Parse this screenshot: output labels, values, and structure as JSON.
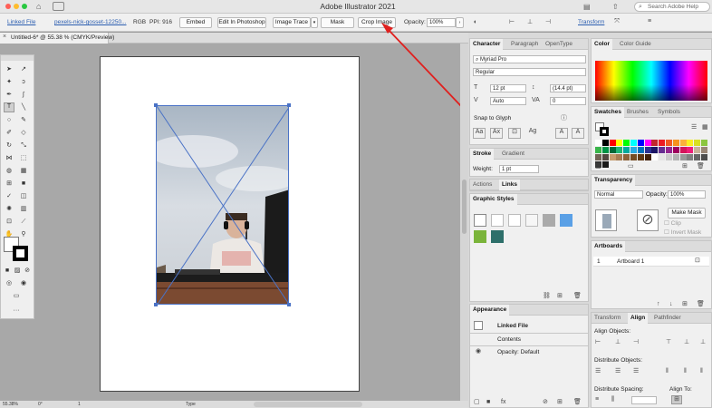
{
  "window": {
    "title": "Adobe Illustrator 2021",
    "search_placeholder": "Search Adobe Help"
  },
  "control_bar": {
    "linked_file": "Linked File",
    "filename": "pexels-nick-gosset-12250...",
    "color_mode": "RGB",
    "ppi": "PPI: 916",
    "embed": "Embed",
    "edit_in_photoshop": "Edit In Photoshop",
    "image_trace": "Image Trace",
    "mask": "Mask",
    "crop_image": "Crop Image",
    "opacity_label": "Opacity:",
    "opacity_value": "100%",
    "transform": "Transform"
  },
  "document_tab": "Untitled-6* @ 55.38 % (CMYK/Preview)",
  "status": {
    "zoom": "55.38%",
    "rotation": "0°",
    "artboard": "1",
    "mode": "Type"
  },
  "character_panel": {
    "tabs": [
      "Character",
      "Paragraph",
      "OpenType"
    ],
    "font": "Myriad Pro",
    "style": "Regular",
    "size": "12 pt",
    "leading": "(14.4 pt)",
    "kerning": "Auto",
    "tracking": "0",
    "snap": "Snap to Glyph"
  },
  "stroke_panel": {
    "tabs": [
      "Stroke",
      "Gradient"
    ],
    "weight_label": "Weight:",
    "weight": "1 pt"
  },
  "actions_panel": {
    "tabs": [
      "Actions",
      "Links"
    ]
  },
  "graphic_styles_panel": {
    "tab": "Graphic Styles"
  },
  "appearance_panel": {
    "tab": "Appearance",
    "item": "Linked File",
    "contents": "Contents",
    "opacity_label": "Opacity:",
    "opacity_value": "Default"
  },
  "color_panel": {
    "tabs": [
      "Color",
      "Color Guide"
    ]
  },
  "swatches_panel": {
    "tabs": [
      "Swatches",
      "Brushes",
      "Symbols"
    ]
  },
  "transparency_panel": {
    "tab": "Transparency",
    "blend": "Normal",
    "opacity_label": "Opacity:",
    "opacity": "100%",
    "make_mask": "Make Mask",
    "clip": "Clip",
    "invert_mask": "Invert Mask"
  },
  "artboards_panel": {
    "tab": "Artboards",
    "rows": [
      {
        "num": "1",
        "name": "Artboard 1"
      }
    ]
  },
  "align_panel": {
    "tabs": [
      "Transform",
      "Align",
      "Pathfinder"
    ],
    "align_objects": "Align Objects:",
    "distribute_objects": "Distribute Objects:",
    "distribute_spacing": "Distribute Spacing:",
    "align_to": "Align To:"
  },
  "colors": {
    "accent_arrow": "#e0201e",
    "selection": "#4a72c6",
    "swatches": [
      "#ffffff",
      "#000000",
      "#ff0000",
      "#ffff00",
      "#00ff00",
      "#00ffff",
      "#0000ff",
      "#ff00ff",
      "#c1272d",
      "#ed1c24",
      "#f15a24",
      "#f7931e",
      "#fbb03b",
      "#fcee21",
      "#d9e021",
      "#8cc63f",
      "#39b54a",
      "#009245",
      "#006837",
      "#22b573",
      "#00a99d",
      "#29abe2",
      "#0071bc",
      "#2e3192",
      "#1b1464",
      "#662d91",
      "#93278f",
      "#9e005d",
      "#d4145a",
      "#ed1e79",
      "#c7b299",
      "#998675",
      "#736357",
      "#534741",
      "#c69c6d",
      "#a67c52",
      "#8c6239",
      "#754c24",
      "#603813",
      "#42210b",
      "#ffffff",
      "#e6e6e6",
      "#cccccc",
      "#b3b3b3",
      "#999999",
      "#808080",
      "#666666",
      "#4d4d4d",
      "#333333",
      "#1a1a1a"
    ]
  }
}
